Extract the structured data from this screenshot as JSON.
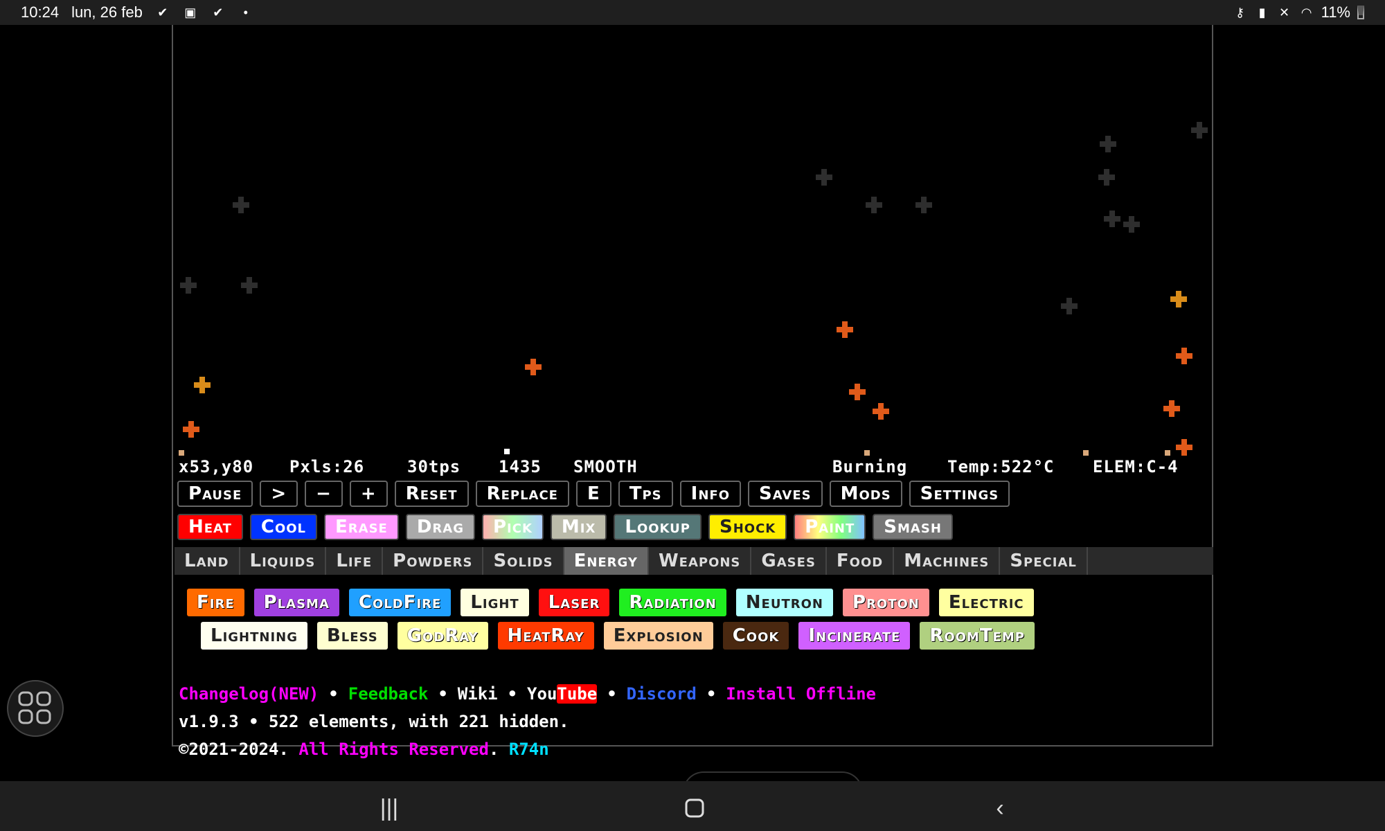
{
  "statusbar": {
    "time": "10:24",
    "date": "lun, 26 feb",
    "battery": "11%"
  },
  "stats": {
    "coords": "x53,y80",
    "pixels": "Pxls:26",
    "tps": "30tps",
    "ticks": "1435",
    "mode": "SMOOTH",
    "hover": "Burning",
    "temp": "Temp:522°C",
    "elem": "ELEM:C-4"
  },
  "controls": [
    "Pause",
    ">",
    "−",
    "+",
    "Reset",
    "Replace",
    "E",
    "Tps",
    "Info",
    "Saves",
    "Mods",
    "Settings"
  ],
  "tools": [
    {
      "label": "Heat",
      "bg": "#ff0000",
      "fg": "#ffffff"
    },
    {
      "label": "Cool",
      "bg": "#0033ff",
      "fg": "#ffffff"
    },
    {
      "label": "Erase",
      "bg": "#ff99ff",
      "fg": "#ffffff"
    },
    {
      "label": "Drag",
      "bg": "#aaaaaa",
      "fg": "#ffffff"
    },
    {
      "label": "Pick",
      "bg": "linear-gradient(90deg,#ffb0b0,#b0ffb0,#b0d0ff)",
      "fg": "#ffffff"
    },
    {
      "label": "Mix",
      "bg": "#bbbbaa",
      "fg": "#ffffff"
    },
    {
      "label": "Lookup",
      "bg": "#557777",
      "fg": "#ffffff"
    },
    {
      "label": "Shock",
      "bg": "#ffee00",
      "fg": "#222222"
    },
    {
      "label": "Paint",
      "bg": "linear-gradient(90deg,#ff8080,#ffff80,#80ff80,#80c0ff)",
      "fg": "#ffffff"
    },
    {
      "label": "Smash",
      "bg": "#777777",
      "fg": "#ffffff"
    }
  ],
  "categories": [
    {
      "label": "Land",
      "active": false
    },
    {
      "label": "Liquids",
      "active": false
    },
    {
      "label": "Life",
      "active": false
    },
    {
      "label": "Powders",
      "active": false
    },
    {
      "label": "Solids",
      "active": false
    },
    {
      "label": "Energy",
      "active": true
    },
    {
      "label": "Weapons",
      "active": false
    },
    {
      "label": "Gases",
      "active": false
    },
    {
      "label": "Food",
      "active": false
    },
    {
      "label": "Machines",
      "active": false
    },
    {
      "label": "Special",
      "active": false
    }
  ],
  "elements_row1": [
    {
      "label": "Fire",
      "bg": "#ff6a00"
    },
    {
      "label": "Plasma",
      "bg": "#a040e0"
    },
    {
      "label": "ColdFire",
      "bg": "#20a0ff"
    },
    {
      "label": "Light",
      "bg": "#ffffe0",
      "dark": true
    },
    {
      "label": "Laser",
      "bg": "#ff1010"
    },
    {
      "label": "Radiation",
      "bg": "#20ee20"
    },
    {
      "label": "Neutron",
      "bg": "#b0ffff",
      "dark": true
    },
    {
      "label": "Proton",
      "bg": "#ff9090"
    },
    {
      "label": "Electric",
      "bg": "#ffffa0",
      "dark": true
    }
  ],
  "elements_row2": [
    {
      "label": "Lightning",
      "bg": "#fffff0",
      "dark": true
    },
    {
      "label": "Bless",
      "bg": "#ffffd0",
      "dark": true
    },
    {
      "label": "GodRay",
      "bg": "#ffffa0"
    },
    {
      "label": "HeatRay",
      "bg": "#ff3a00"
    },
    {
      "label": "Explosion",
      "bg": "#ffcc99",
      "dark": true
    },
    {
      "label": "Cook",
      "bg": "#4a2810"
    },
    {
      "label": "Incinerate",
      "bg": "#d060ff"
    },
    {
      "label": "RoomTemp",
      "bg": "#b0d080"
    }
  ],
  "links": {
    "changelog": "Changelog(NEW)",
    "feedback": "Feedback",
    "wiki": "Wiki",
    "youtube_a": "You",
    "youtube_b": "Tube",
    "discord": "Discord",
    "install": "Install Offline",
    "separator": "•"
  },
  "version": "v1.9.3 • 522 elements, with 221 hidden.",
  "copyright": {
    "year": "©2021-2024.",
    "rights": "All Rights Reserved",
    "period": ".",
    "author": "R74n"
  },
  "colors": {
    "smoke": "#2e2e2e",
    "fire_orange": "#e05a1a",
    "fire_amber": "#d98c1a",
    "link_pink": "#ff00ff",
    "link_green": "#00e000",
    "link_blue": "#3366ff",
    "link_cyan": "#00e0ff"
  }
}
